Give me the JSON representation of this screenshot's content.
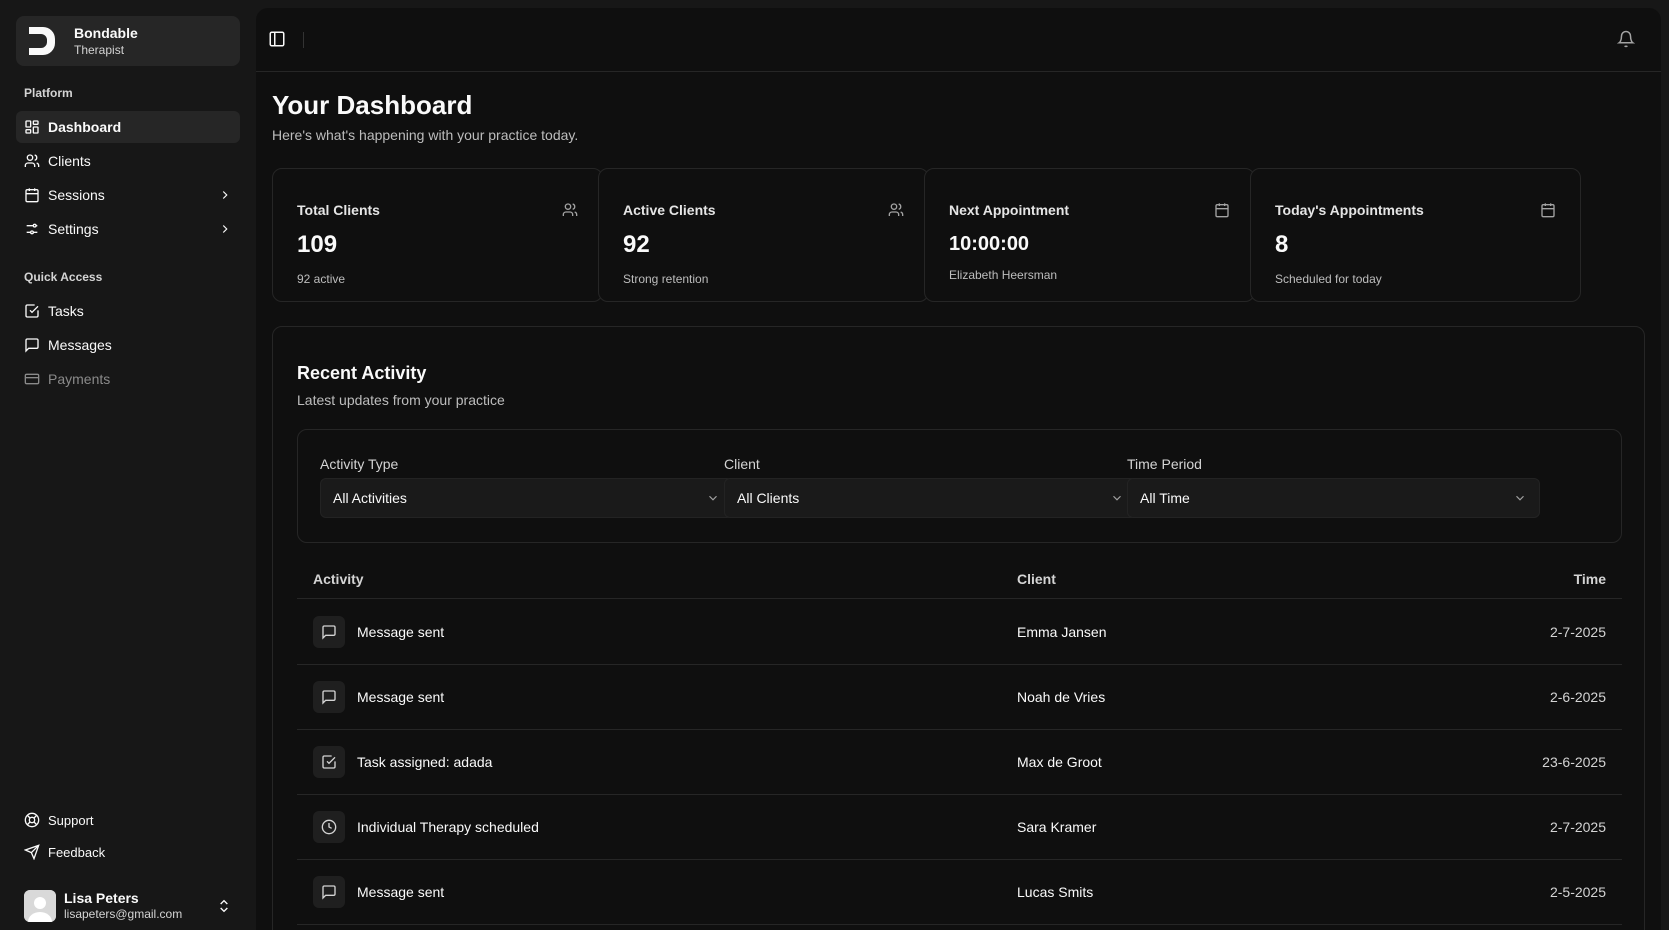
{
  "brand": {
    "name": "Bondable",
    "role": "Therapist"
  },
  "sidebar": {
    "platform_label": "Platform",
    "platform_items": [
      {
        "label": "Dashboard",
        "icon": "layout-grid-icon",
        "active": true
      },
      {
        "label": "Clients",
        "icon": "users-icon"
      },
      {
        "label": "Sessions",
        "icon": "calendar-icon",
        "expandable": true
      },
      {
        "label": "Settings",
        "icon": "sliders-icon",
        "expandable": true
      }
    ],
    "quick_label": "Quick Access",
    "quick_items": [
      {
        "label": "Tasks",
        "icon": "check-square-icon"
      },
      {
        "label": "Messages",
        "icon": "message-square-icon"
      },
      {
        "label": "Payments",
        "icon": "credit-card-icon",
        "disabled": true
      }
    ],
    "footer_items": [
      {
        "label": "Support",
        "icon": "life-buoy-icon"
      },
      {
        "label": "Feedback",
        "icon": "send-icon"
      }
    ],
    "user": {
      "name": "Lisa Peters",
      "email": "lisapeters@gmail.com"
    }
  },
  "header": {
    "title": "Your Dashboard",
    "subtitle": "Here's what's happening with your practice today."
  },
  "stats": [
    {
      "label": "Total Clients",
      "value": "109",
      "note": "92 active",
      "icon": "users-icon"
    },
    {
      "label": "Active Clients",
      "value": "92",
      "note": "Strong retention",
      "icon": "users-icon"
    },
    {
      "label": "Next Appointment",
      "value": "10:00:00",
      "note": "Elizabeth Heersman",
      "icon": "calendar-icon"
    },
    {
      "label": "Today's Appointments",
      "value": "8",
      "note": "Scheduled for today",
      "icon": "calendar-icon"
    }
  ],
  "activity": {
    "title": "Recent Activity",
    "subtitle": "Latest updates from your practice",
    "filters": [
      {
        "label": "Activity Type",
        "value": "All Activities"
      },
      {
        "label": "Client",
        "value": "All Clients"
      },
      {
        "label": "Time Period",
        "value": "All Time"
      }
    ],
    "columns": {
      "activity": "Activity",
      "client": "Client",
      "time": "Time"
    },
    "rows": [
      {
        "activity": "Message sent",
        "client": "Emma Jansen",
        "time": "2-7-2025",
        "icon": "message-square-icon"
      },
      {
        "activity": "Message sent",
        "client": "Noah de Vries",
        "time": "2-6-2025",
        "icon": "message-square-icon"
      },
      {
        "activity": "Task assigned: adada",
        "client": "Max de Groot",
        "time": "23-6-2025",
        "icon": "check-square-icon"
      },
      {
        "activity": "Individual Therapy scheduled",
        "client": "Sara Kramer",
        "time": "2-7-2025",
        "icon": "clock-icon"
      },
      {
        "activity": "Message sent",
        "client": "Lucas Smits",
        "time": "2-5-2025",
        "icon": "message-square-icon"
      }
    ]
  }
}
